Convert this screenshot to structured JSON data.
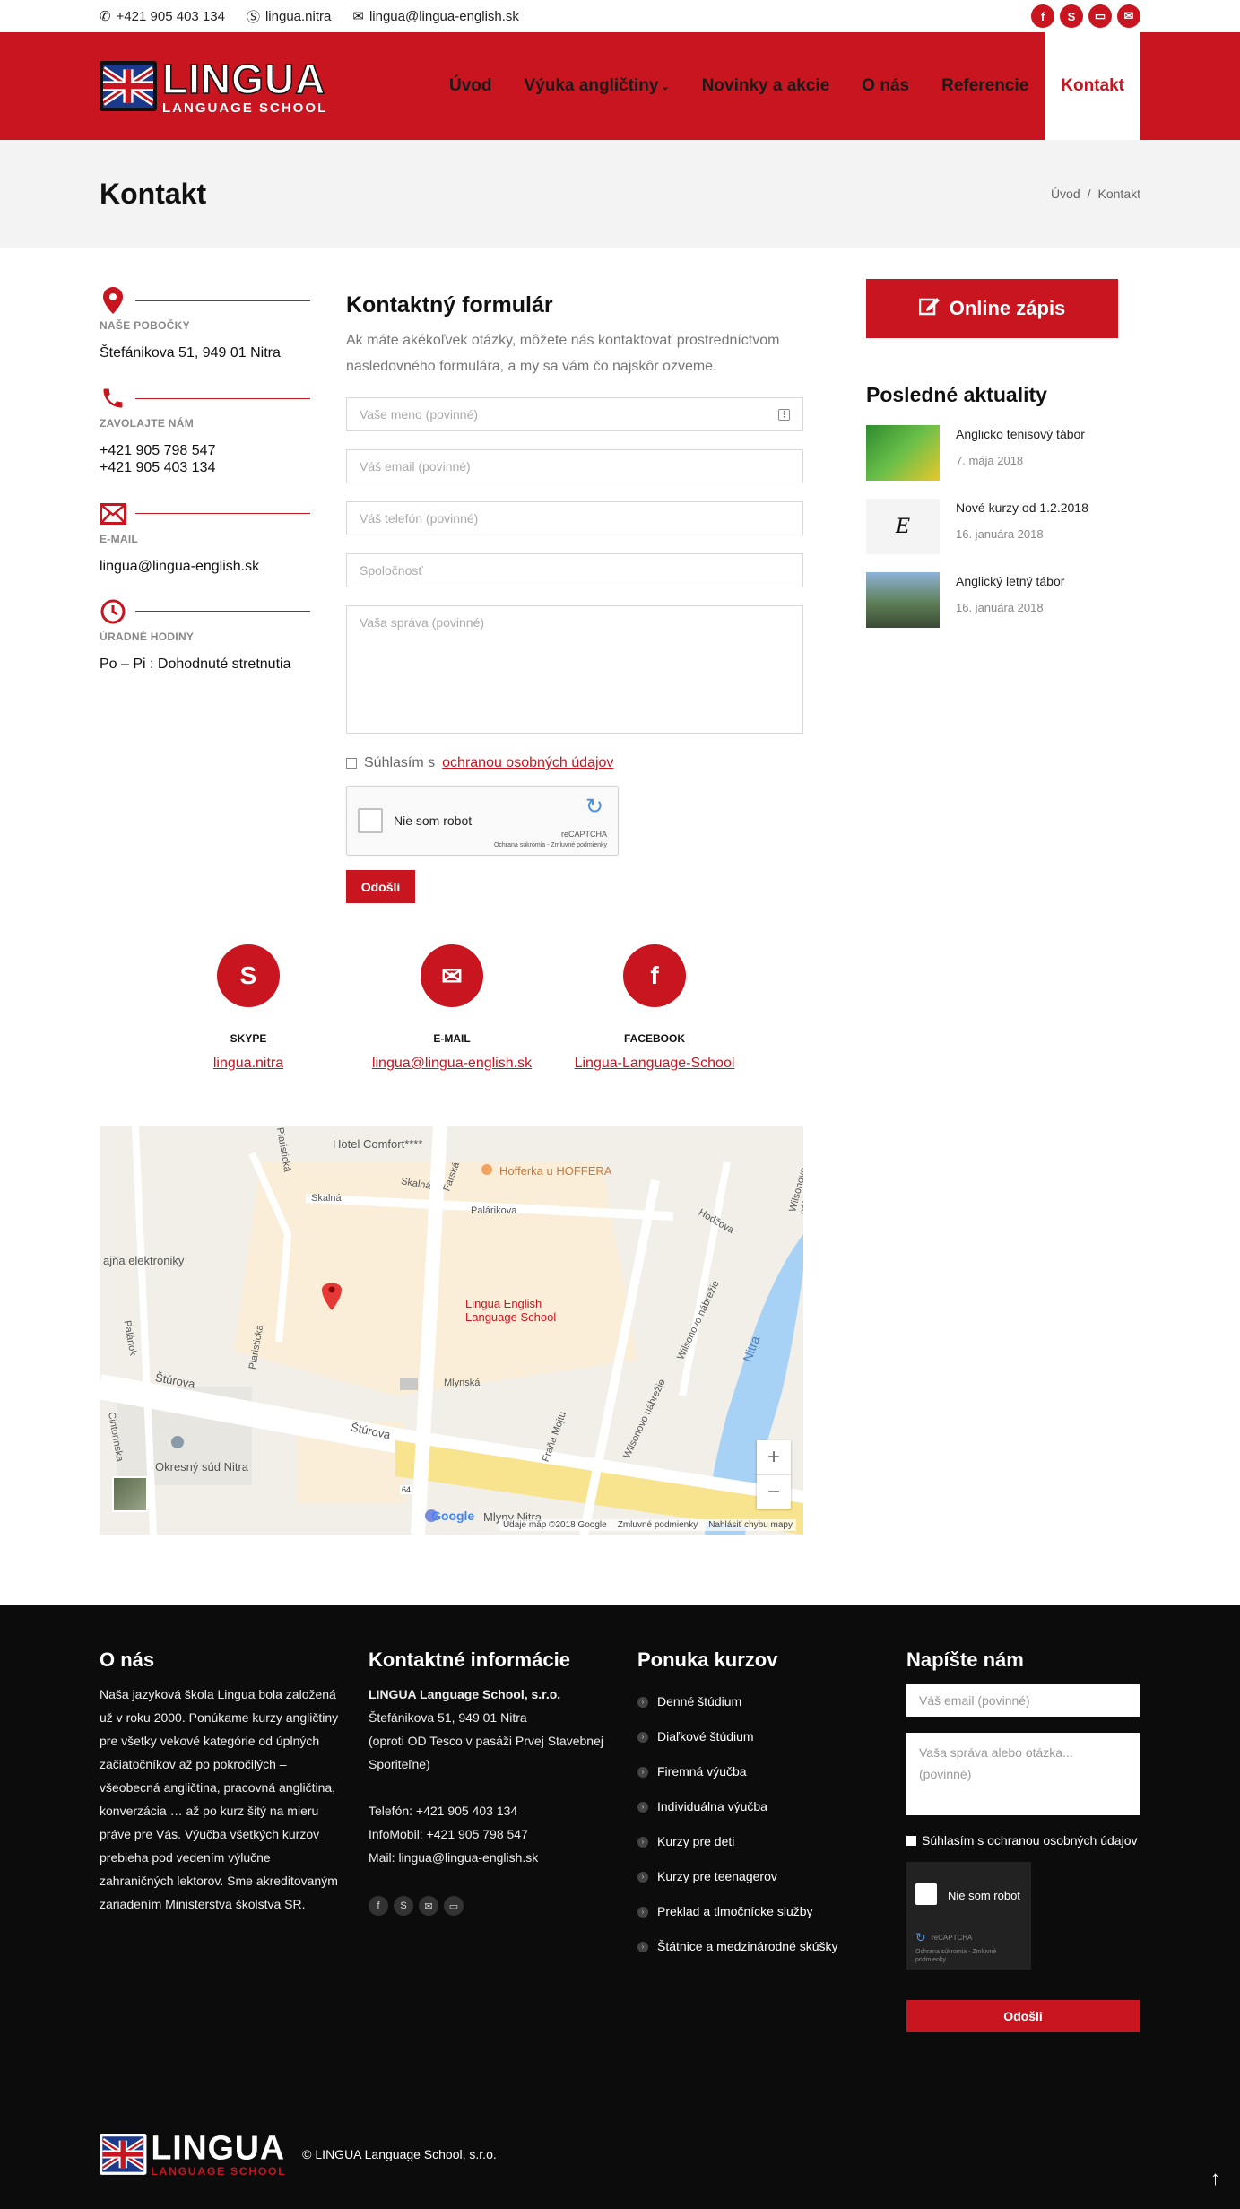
{
  "topbar": {
    "phone": "+421 905 403 134",
    "skype": "lingua.nitra",
    "email": "lingua@lingua-english.sk"
  },
  "logo": {
    "name": "LINGUA",
    "tagline": "LANGUAGE SCHOOL"
  },
  "nav": [
    {
      "label": "Úvod"
    },
    {
      "label": "Výuka angličtiny"
    },
    {
      "label": "Novinky a akcie"
    },
    {
      "label": "O nás"
    },
    {
      "label": "Referencie"
    },
    {
      "label": "Kontakt"
    }
  ],
  "page": {
    "title": "Kontakt",
    "breadcrumb_home": "Úvod",
    "breadcrumb_current": "Kontakt"
  },
  "info": [
    {
      "label": "NAŠE POBOČKY",
      "value": "Štefánikova 51, 949 01 Nitra"
    },
    {
      "label": "ZAVOLAJTE NÁM",
      "value": "+421 905 798 547",
      "value2": "+421 905 403 134"
    },
    {
      "label": "E-MAIL",
      "value": "lingua@lingua-english.sk"
    },
    {
      "label": "ÚRADNÉ HODINY",
      "value": "Po – Pi : Dohodnuté stretnutia"
    }
  ],
  "form": {
    "title": "Kontaktný formulár",
    "description": "Ak máte akékoľvek otázky, môžete nás kontaktovať prostredníctvom nasledovného formulára, a my sa vám čo najskôr ozveme.",
    "name_placeholder": "Vaše meno (povinné)",
    "email_placeholder": "Váš email (povinné)",
    "phone_placeholder": "Váš telefón (povinné)",
    "company_placeholder": "Spoločnosť",
    "message_placeholder": "Vaša správa (povinné)",
    "consent_prefix": "Súhlasím s",
    "consent_link": "ochranou osobných údajov",
    "captcha_label": "Nie som robot",
    "captcha_brand": "reCAPTCHA",
    "captcha_terms": "Ochrana súkromia - Zmluvné podmienky",
    "submit": "Odošli"
  },
  "sidebar": {
    "cta": "Online zápis",
    "news_title": "Posledné aktuality",
    "news": [
      {
        "title": "Anglicko tenisový tábor",
        "date": "7. mája 2018"
      },
      {
        "title": "Nové kurzy od 1.2.2018",
        "date": "16. januára 2018"
      },
      {
        "title": "Anglický letný tábor",
        "date": "16. januára 2018"
      }
    ]
  },
  "contacts": [
    {
      "label": "SKYPE",
      "link": "lingua.nitra"
    },
    {
      "label": "E-MAIL",
      "link": "lingua@lingua-english.sk"
    },
    {
      "label": "FACEBOOK",
      "link": "Lingua-Language-School"
    }
  ],
  "map": {
    "pin_label_1": "Lingua English",
    "pin_label_2": "Language School",
    "places": [
      "Hotel Comfort****",
      "Hofferka u HOFFERA",
      "Okresný súd Nitra",
      "Mlyny Nitra",
      "Nitra",
      "ajňa elektroniky"
    ],
    "streets": [
      "Štúrova",
      "Štúrova",
      "Palárikova",
      "Mlynská",
      "Skalná",
      "Skalná",
      "Farská",
      "Hodžova",
      "Wilsonovo nábrežie",
      "Wilsonovo nábrežie",
      "Piaristická",
      "Piaristická",
      "Cintorínska",
      "Palánok",
      "Fraňa Mojtu",
      "Wilsonovo nábr"
    ],
    "road_number": "64",
    "attribution": "Údaje máp ©2018 Google",
    "terms": "Zmluvné podmienky",
    "report": "Nahlásiť chybu mapy",
    "brand": "Google"
  },
  "footer": {
    "about_title": "O nás",
    "about_text": "Naša jazyková škola Lingua bola založená už v roku 2000. Ponúkame kurzy angličtiny pre všetky vekové kategórie od úplných začiatočníkov až po pokročilých – všeobecná angličtina, pracovná angličtina, konverzácia … až po kurz šitý na mieru práve pre Vás. Výučba všetkých kurzov prebieha pod vedením výlučne zahraničných lektorov. Sme akreditovaným zariadením Ministerstva školstva SR.",
    "contact_title": "Kontaktné informácie",
    "company": "LINGUA Language School, s.r.o.",
    "address": "Štefánikova 51, 949 01 Nitra",
    "address_note": "(oproti OD Tesco v pasáži Prvej Stavebnej Sporiteľne)",
    "phone": "Telefón: +421 905 403 134",
    "mobile": "InfoMobil: +421 905 798 547",
    "mail": "Mail: lingua@lingua-english.sk",
    "courses_title": "Ponuka kurzov",
    "courses": [
      "Denné štúdium",
      "Diaľkové štúdium",
      "Firemná výučba",
      "Individuálna výučba",
      "Kurzy pre deti",
      "Kurzy pre teenagerov",
      "Preklad a tlmočnícke služby",
      "Štátnice a medzinárodné skúšky"
    ],
    "write_title": "Napíšte nám",
    "email_placeholder": "Váš email (povinné)",
    "message_placeholder": "Vaša správa alebo otázka... (povinné)",
    "consent": "Súhlasím s ochranou osobných údajov",
    "captcha_label": "Nie som robot",
    "captcha_brand": "reCAPTCHA",
    "captcha_terms": "Ochrana súkromia - Zmluvné podmienky",
    "submit": "Odošli",
    "copyright": "LINGUA Language School, s.r.o."
  },
  "colors": {
    "brand": "#c8151f",
    "footer_bg": "#0c0c0c",
    "title_bg": "#f3f3f3"
  }
}
